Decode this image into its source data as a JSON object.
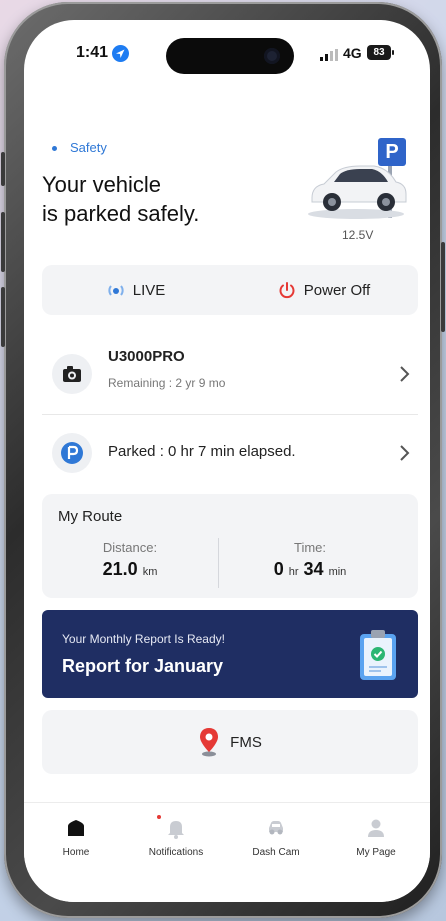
{
  "status_bar": {
    "time": "1:41",
    "network": "4G",
    "battery": "83"
  },
  "header": {
    "badge": "Safety",
    "line1": "Your vehicle",
    "line2": "is parked safely.",
    "voltage": "12.5V",
    "parking_sign": "P"
  },
  "controls": {
    "live_label": "LIVE",
    "power_label": "Power Off"
  },
  "device": {
    "name": "U3000PRO",
    "remaining": "Remaining : 2 yr 9 mo"
  },
  "parked": {
    "text": "Parked : 0 hr 7 min elapsed."
  },
  "route": {
    "title": "My Route",
    "distance_label": "Distance:",
    "distance_value": "21.0",
    "distance_unit": "km",
    "time_label": "Time:",
    "time_hours": "0",
    "time_hr_unit": "hr",
    "time_minutes": "34",
    "time_min_unit": "min"
  },
  "report": {
    "subtitle": "Your Monthly Report Is Ready!",
    "title": "Report for January"
  },
  "fms": {
    "label": "FMS"
  },
  "tabs": [
    {
      "label": "Home"
    },
    {
      "label": "Notifications"
    },
    {
      "label": "Dash Cam"
    },
    {
      "label": "My Page"
    }
  ],
  "colors": {
    "accent": "#2f78d6",
    "power": "#e53935",
    "report_bg": "#1f2e63"
  }
}
